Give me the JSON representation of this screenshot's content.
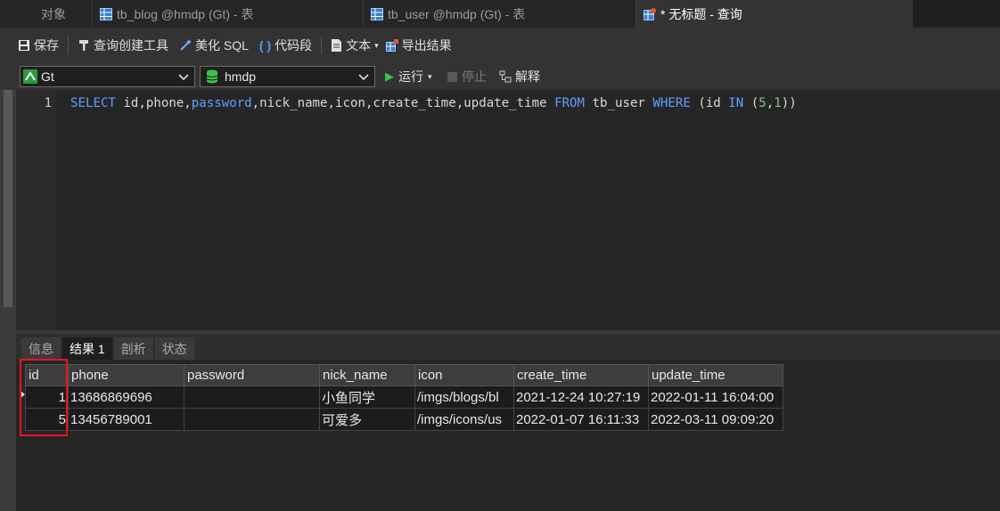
{
  "tabs": [
    {
      "label": "对象",
      "icon": "none"
    },
    {
      "label": "tb_blog @hmdp (Gt) - 表",
      "icon": "table-icon"
    },
    {
      "label": "tb_user @hmdp (Gt) - 表",
      "icon": "table-icon"
    },
    {
      "label": "* 无标题 - 查询",
      "icon": "query-icon"
    }
  ],
  "toolbar": {
    "save": "保存",
    "query_builder": "查询创建工具",
    "beautify_sql": "美化 SQL",
    "code_snippet": "代码段",
    "text": "文本",
    "export": "导出结果"
  },
  "connection": {
    "server": "Gt",
    "database": "hmdp",
    "run": "运行",
    "stop": "停止",
    "explain": "解释"
  },
  "editor": {
    "line_number": "1",
    "tokens": [
      {
        "t": "SELECT",
        "c": "kw"
      },
      {
        "t": " id,phone,",
        "c": ""
      },
      {
        "t": "password",
        "c": "kw"
      },
      {
        "t": ",nick_name,icon,create_time,update_time ",
        "c": ""
      },
      {
        "t": "FROM",
        "c": "kw"
      },
      {
        "t": " tb_user ",
        "c": ""
      },
      {
        "t": "WHERE",
        "c": "kw"
      },
      {
        "t": " (id ",
        "c": ""
      },
      {
        "t": "IN",
        "c": "kw"
      },
      {
        "t": " (",
        "c": ""
      },
      {
        "t": "5",
        "c": "num"
      },
      {
        "t": ",",
        "c": ""
      },
      {
        "t": "1",
        "c": "num"
      },
      {
        "t": "))",
        "c": ""
      }
    ]
  },
  "result_tabs": [
    "信息",
    "结果 1",
    "剖析",
    "状态"
  ],
  "results": {
    "columns": [
      "id",
      "phone",
      "password",
      "nick_name",
      "icon",
      "create_time",
      "update_time"
    ],
    "rows": [
      [
        "1",
        "13686869696",
        "",
        "小鱼同学",
        "/imgs/blogs/bl",
        "2021-12-24 10:27:19",
        "2022-01-11 16:04:00"
      ],
      [
        "5",
        "13456789001",
        "",
        "可爱多",
        "/imgs/icons/us",
        "2022-01-07 16:11:33",
        "2022-03-11 09:09:20"
      ]
    ]
  },
  "colors": {
    "highlight_box": "#e8141e",
    "keyword": "#5f9fff",
    "number": "#86c28a",
    "run_green": "#3cc44a"
  }
}
